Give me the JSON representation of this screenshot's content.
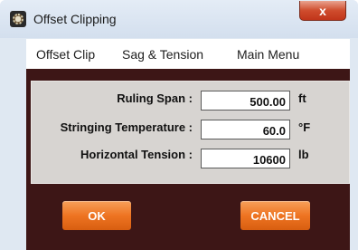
{
  "window": {
    "title": "Offset Clipping",
    "close_glyph": "x",
    "app_icon": "app-icon"
  },
  "menu": {
    "items": [
      "Offset Clip",
      "Sag & Tension",
      "Main Menu"
    ]
  },
  "form": {
    "fields": [
      {
        "label": "Ruling Span :",
        "value": "500.00",
        "unit": "ft"
      },
      {
        "label": "Stringing Temperature :",
        "value": "60.0",
        "unit": "°F"
      },
      {
        "label": "Horizontal Tension :",
        "value": "10600",
        "unit": "lb"
      }
    ]
  },
  "buttons": {
    "ok": "OK",
    "cancel": "CANCEL"
  },
  "colors": {
    "client_background": "#3d1616",
    "panel_background": "#d7d4d1",
    "button_orange": "#ee7422",
    "close_red": "#c1351a"
  }
}
